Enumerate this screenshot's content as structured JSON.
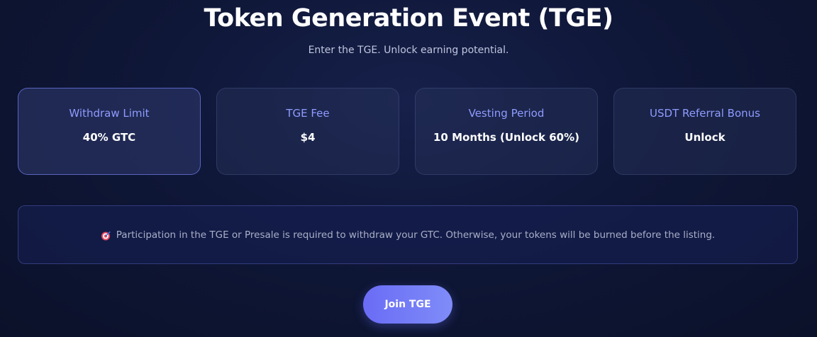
{
  "header": {
    "title": "Token Generation Event (TGE)",
    "subtitle": "Enter the TGE. Unlock earning potential."
  },
  "cards": [
    {
      "label": "Withdraw Limit",
      "value": "40% GTC",
      "active": true
    },
    {
      "label": "TGE Fee",
      "value": "$4",
      "active": false
    },
    {
      "label": "Vesting Period",
      "value": "10 Months (Unlock 60%)",
      "active": false
    },
    {
      "label": "USDT Referral Bonus",
      "value": "Unlock",
      "active": false
    }
  ],
  "notice": {
    "icon": "target-icon",
    "text": "Participation in the TGE or Presale is required to withdraw your GTC. Otherwise, your tokens will be burned before the listing."
  },
  "cta": {
    "label": "Join TGE"
  },
  "colors": {
    "accent": "#8f9bff",
    "button": "#6a6cf5",
    "background": "#0f1738"
  }
}
